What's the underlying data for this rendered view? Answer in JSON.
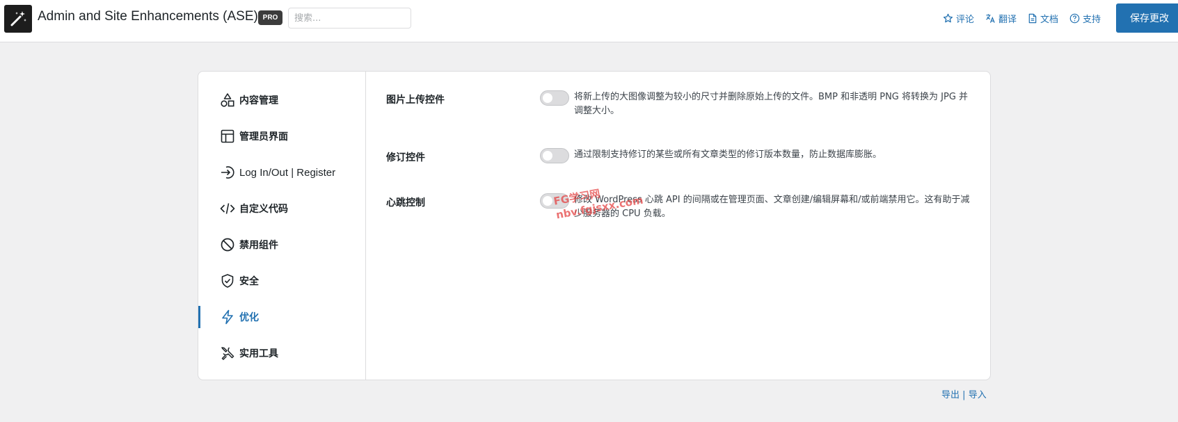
{
  "header": {
    "app_title": "Admin and Site Enhancements (ASE)",
    "pro_badge": "PRO",
    "search_placeholder": "搜索...",
    "links": [
      {
        "label": "评论",
        "icon": "star-icon"
      },
      {
        "label": "翻译",
        "icon": "translate-icon"
      },
      {
        "label": "文档",
        "icon": "document-icon"
      },
      {
        "label": "支持",
        "icon": "help-circle-icon"
      }
    ],
    "save_label": "保存更改"
  },
  "sidebar": {
    "items": [
      {
        "label": "内容管理",
        "icon": "shapes-icon"
      },
      {
        "label": "管理员界面",
        "icon": "layout-icon"
      },
      {
        "label": "Log In/Out | Register",
        "icon": "login-icon"
      },
      {
        "label": "自定义代码",
        "icon": "code-icon"
      },
      {
        "label": "禁用组件",
        "icon": "block-icon"
      },
      {
        "label": "安全",
        "icon": "shield-check-icon"
      },
      {
        "label": "优化",
        "icon": "lightning-icon",
        "active": true
      },
      {
        "label": "实用工具",
        "icon": "tools-icon"
      }
    ]
  },
  "settings": [
    {
      "title": "图片上传控件",
      "enabled": false,
      "description": "将新上传的大图像调整为较小的尺寸并删除原始上传的文件。BMP 和非透明 PNG 将转换为 JPG 并调整大小。"
    },
    {
      "title": "修订控件",
      "enabled": false,
      "description": "通过限制支持修订的某些或所有文章类型的修订版本数量，防止数据库膨胀。"
    },
    {
      "title": "心跳控制",
      "enabled": false,
      "description": "修改 WordPress 心跳 API 的间隔或在管理页面、文章创建/编辑屏幕和/或前端禁用它。这有助于减少服务器的 CPU 负载。"
    }
  ],
  "watermark": {
    "line1": "FG学习网",
    "line2": "nbv.fgjsxx.com"
  },
  "footer": {
    "export_label": "导出",
    "separator": "|",
    "import_label": "导入"
  },
  "colors": {
    "accent": "#2271b1",
    "background": "#f0f0f1",
    "watermark": "#e54545"
  }
}
